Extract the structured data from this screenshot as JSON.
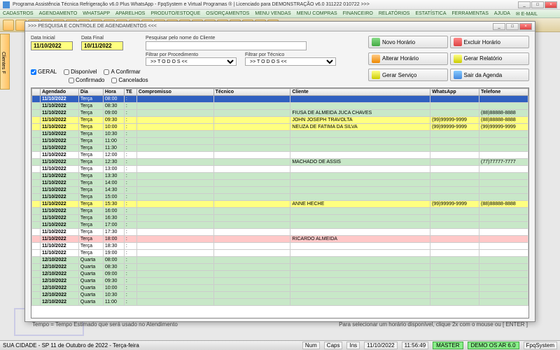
{
  "title": "Programa Assistência Técnica Refrigeração v6.0 Plus WhatsApp - FpqSystem e Virtual Programas ® | Licenciado para  DEMONSTRAÇÃO v6.0 311222 010722 >>>",
  "menu": [
    "CADASTROS",
    "AGENDAMENTO",
    "WHATSAPP",
    "APARELHOS",
    "PRODUTO/ESTOQUE",
    "OS/ORÇAMENTOS",
    "MENU VENDAS",
    "MENU COMPRAS",
    "FINANCEIRO",
    "RELATÓRIOS",
    "ESTATÍSTICA",
    "FERRAMENTAS",
    "AJUDA",
    "✉ E-MAIL"
  ],
  "sidetab": "Clientes F",
  "dialog": {
    "title": ">>>  PESQUISA E CONTROLE DE AGENDAMENTOS  <<<",
    "dates": {
      "initial_label": "Data Inicial",
      "initial": "11/10/2022",
      "final_label": "Data Final",
      "final": "10/11/2022"
    },
    "checks": {
      "geral": "GERAL",
      "disponivel": "Disponível",
      "aconfirmar": "A Confirmar",
      "confirmado": "Confirmado",
      "cancelados": "Cancelados"
    },
    "search": {
      "label": "Pesquisar pelo nome do Cliente",
      "value": ""
    },
    "filters": {
      "proc_label": "Filtrar por Procedimento",
      "proc": ">> T O D O S <<",
      "tec_label": "Filtrar por Técnico",
      "tec": ">> T O D O S <<"
    },
    "buttons": {
      "novo": "Novo Horário",
      "excluir": "Excluir Horário",
      "alterar": "Alterar Horário",
      "relatorio": "Gerar Relatório",
      "servico": "Gerar  Serviço",
      "sair": "Sair da Agenda"
    },
    "columns": [
      "",
      "Agendado",
      "Dia",
      "Hora",
      "TE",
      "Compromisso",
      "Técnico",
      "Cliente",
      "WhatsApp",
      "Telefone"
    ],
    "rows": [
      {
        "c": "sel",
        "d": "11/10/2022",
        "dia": "Terça",
        "h": "08:00",
        "cli": "",
        "wa": "",
        "tel": ""
      },
      {
        "c": "green",
        "d": "11/10/2022",
        "dia": "Terça",
        "h": "08:30",
        "cli": "",
        "wa": "",
        "tel": ""
      },
      {
        "c": "green",
        "d": "11/10/2022",
        "dia": "Terça",
        "h": "09:00",
        "cli": "FIUSA DE ALMEIDA JUCA CHAVES",
        "wa": "",
        "tel": "(88)88888-8888"
      },
      {
        "c": "yellow",
        "d": "11/10/2022",
        "dia": "Terça",
        "h": "09:30",
        "cli": "JOHN JOSEPH TRAVOLTA",
        "wa": "(99)99999-9999",
        "tel": "(88)88888-8888"
      },
      {
        "c": "yellow",
        "d": "11/10/2022",
        "dia": "Terça",
        "h": "10:00",
        "cli": "NEUZA DE FATIMA DA SILVA",
        "wa": "(99)99999-9999",
        "tel": "(99)99999-9999"
      },
      {
        "c": "green",
        "d": "11/10/2022",
        "dia": "Terça",
        "h": "10:30",
        "cli": "",
        "wa": "",
        "tel": ""
      },
      {
        "c": "green",
        "d": "11/10/2022",
        "dia": "Terça",
        "h": "11:00",
        "cli": "",
        "wa": "",
        "tel": ""
      },
      {
        "c": "green",
        "d": "11/10/2022",
        "dia": "Terça",
        "h": "11:30",
        "cli": "",
        "wa": "",
        "tel": ""
      },
      {
        "c": "white",
        "d": "11/10/2022",
        "dia": "Terça",
        "h": "12:00",
        "cli": "",
        "wa": "",
        "tel": ""
      },
      {
        "c": "green",
        "d": "11/10/2022",
        "dia": "Terça",
        "h": "12:30",
        "cli": "MACHADO DE ASSIS",
        "wa": "",
        "tel": "(77)77777-7777"
      },
      {
        "c": "white",
        "d": "11/10/2022",
        "dia": "Terça",
        "h": "13:00",
        "cli": "",
        "wa": "",
        "tel": ""
      },
      {
        "c": "green",
        "d": "11/10/2022",
        "dia": "Terça",
        "h": "13:30",
        "cli": "",
        "wa": "",
        "tel": ""
      },
      {
        "c": "green",
        "d": "11/10/2022",
        "dia": "Terça",
        "h": "14:00",
        "cli": "",
        "wa": "",
        "tel": ""
      },
      {
        "c": "green",
        "d": "11/10/2022",
        "dia": "Terça",
        "h": "14:30",
        "cli": "",
        "wa": "",
        "tel": ""
      },
      {
        "c": "green",
        "d": "11/10/2022",
        "dia": "Terça",
        "h": "15:00",
        "cli": "",
        "wa": "",
        "tel": ""
      },
      {
        "c": "yellow",
        "d": "11/10/2022",
        "dia": "Terça",
        "h": "15:30",
        "cli": "ANNE HECHE",
        "wa": "(99)99999-9999",
        "tel": "(88)88888-8888"
      },
      {
        "c": "green",
        "d": "11/10/2022",
        "dia": "Terça",
        "h": "16:00",
        "cli": "",
        "wa": "",
        "tel": ""
      },
      {
        "c": "green",
        "d": "11/10/2022",
        "dia": "Terça",
        "h": "16:30",
        "cli": "",
        "wa": "",
        "tel": ""
      },
      {
        "c": "green",
        "d": "11/10/2022",
        "dia": "Terça",
        "h": "17:00",
        "cli": "",
        "wa": "",
        "tel": ""
      },
      {
        "c": "white",
        "d": "11/10/2022",
        "dia": "Terça",
        "h": "17:30",
        "cli": "",
        "wa": "",
        "tel": ""
      },
      {
        "c": "pink",
        "d": "11/10/2022",
        "dia": "Terça",
        "h": "18:00",
        "cli": "RICARDO ALMEIDA",
        "wa": "",
        "tel": ""
      },
      {
        "c": "white",
        "d": "11/10/2022",
        "dia": "Terça",
        "h": "18:30",
        "cli": "",
        "wa": "",
        "tel": ""
      },
      {
        "c": "white",
        "d": "11/10/2022",
        "dia": "Terça",
        "h": "19:00",
        "cli": "",
        "wa": "",
        "tel": ""
      },
      {
        "c": "green",
        "d": "12/10/2022",
        "dia": "Quarta",
        "h": "08:00",
        "cli": "",
        "wa": "",
        "tel": ""
      },
      {
        "c": "green",
        "d": "12/10/2022",
        "dia": "Quarta",
        "h": "08:30",
        "cli": "",
        "wa": "",
        "tel": ""
      },
      {
        "c": "green",
        "d": "12/10/2022",
        "dia": "Quarta",
        "h": "09:00",
        "cli": "",
        "wa": "",
        "tel": ""
      },
      {
        "c": "green",
        "d": "12/10/2022",
        "dia": "Quarta",
        "h": "09:30",
        "cli": "",
        "wa": "",
        "tel": ""
      },
      {
        "c": "green",
        "d": "12/10/2022",
        "dia": "Quarta",
        "h": "10:00",
        "cli": "",
        "wa": "",
        "tel": ""
      },
      {
        "c": "green",
        "d": "12/10/2022",
        "dia": "Quarta",
        "h": "10:30",
        "cli": "",
        "wa": "",
        "tel": ""
      },
      {
        "c": "green",
        "d": "12/10/2022",
        "dia": "Quarta",
        "h": "11:00",
        "cli": "",
        "wa": "",
        "tel": ""
      }
    ],
    "hint_left": "Tempo = Tempo Estimado que será usado no Atendimento",
    "hint_right": "Para selecionar um horário disponível, clique 2x com o mouse ou [ ENTER ]"
  },
  "status": {
    "location": "SUA CIDADE - SP 11 de Outubro de 2022 - Terça-feira",
    "num": "Num",
    "caps": "Caps",
    "ins": "Ins",
    "date": "11/10/2022",
    "time": "11:56:49",
    "master": "MASTER",
    "demo": "DEMO OS AR 6.0",
    "brand": "FpqSystem"
  }
}
